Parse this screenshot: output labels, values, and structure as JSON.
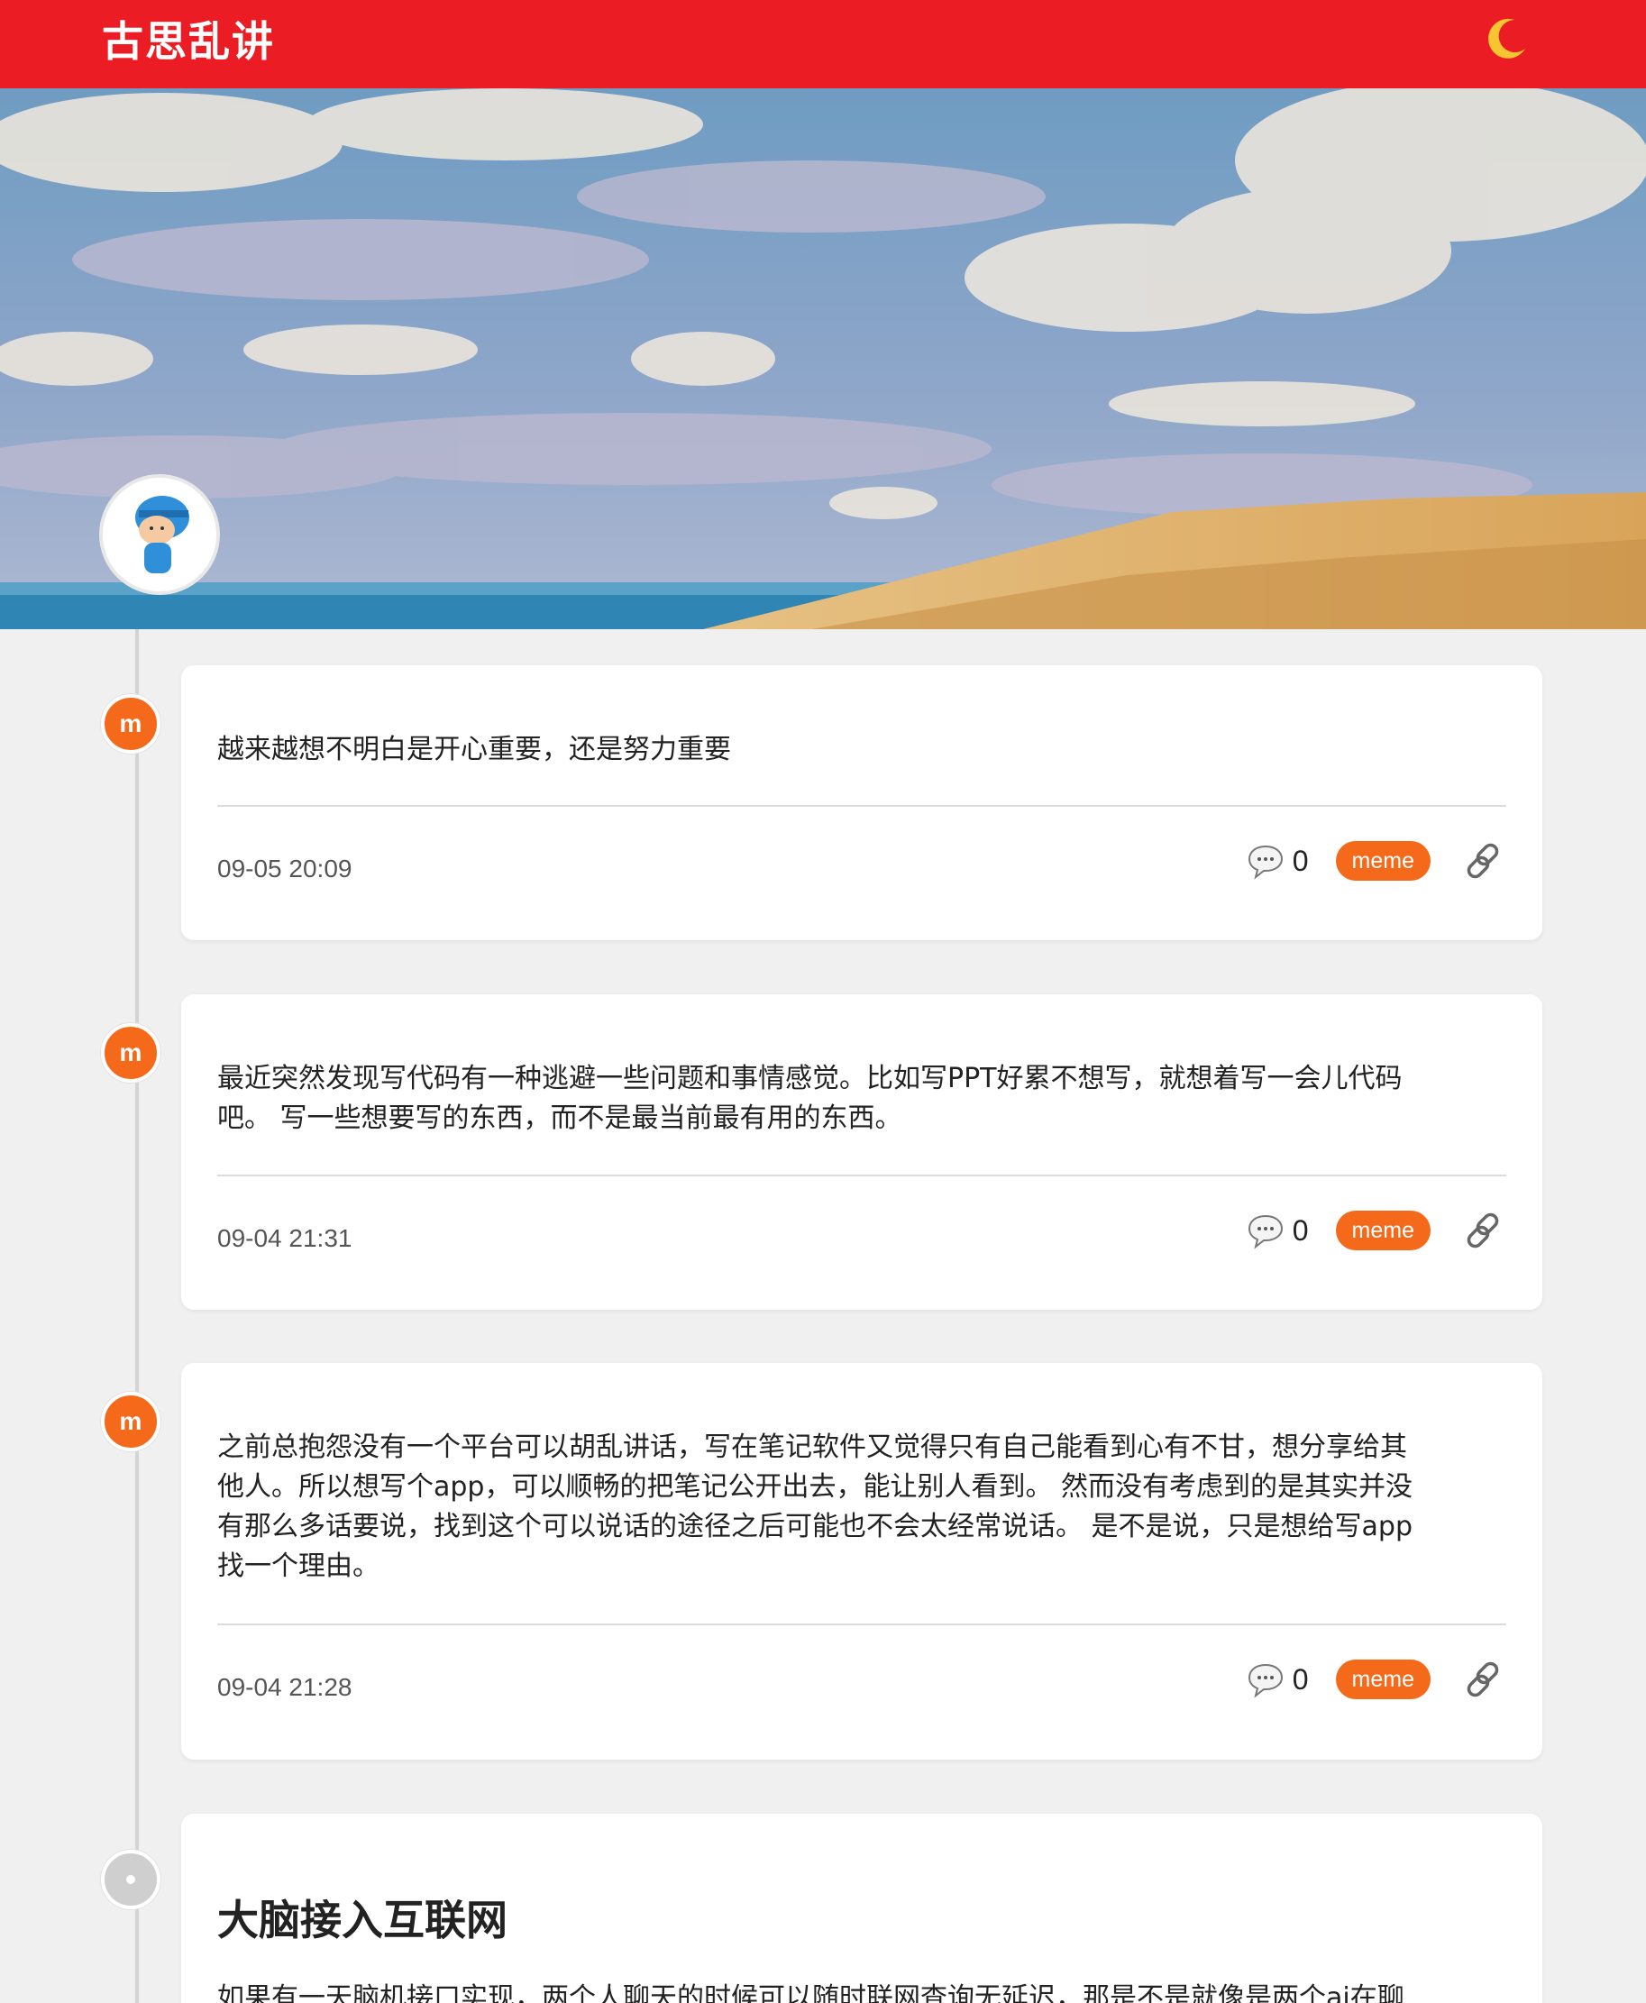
{
  "header": {
    "site_title": "古思乱讲",
    "theme_icon": "moon-icon"
  },
  "colors": {
    "header_bg": "#ec1c24",
    "accent": "#f56a1a",
    "page_bg": "#f0f0f0"
  },
  "posts": [
    {
      "avatar_letter": "m",
      "text": "越来越想不明白是开心重要，还是努力重要",
      "time": "09-05 20:09",
      "comments": "0",
      "tag": "meme"
    },
    {
      "avatar_letter": "m",
      "text_lines": [
        "最近突然发现写代码有一种逃避一些问题和事情感觉。比如写PPT好累不想写，就想着写一会儿代码",
        "吧。 写一些想要写的东西，而不是最当前最有用的东西。"
      ],
      "time": "09-04 21:31",
      "comments": "0",
      "tag": "meme"
    },
    {
      "avatar_letter": "m",
      "text_lines": [
        "之前总抱怨没有一个平台可以胡乱讲话，写在笔记软件又觉得只有自己能看到心有不甘，想分享给其",
        "他人。所以想写个app，可以顺畅的把笔记公开出去，能让别人看到。 然而没有考虑到的是其实并没",
        "有那么多话要说，找到这个可以说话的途径之后可能也不会太经常说话。 是不是说，只是想给写app",
        "找一个理由。"
      ],
      "time": "09-04 21:28",
      "comments": "0",
      "tag": "meme"
    },
    {
      "title": "大脑接入互联网",
      "text_partial": "如果有一天脑机接口实现，两个人聊天的时候可以随时联网查询无延迟，那是不是就像是两个ai在聊"
    }
  ]
}
